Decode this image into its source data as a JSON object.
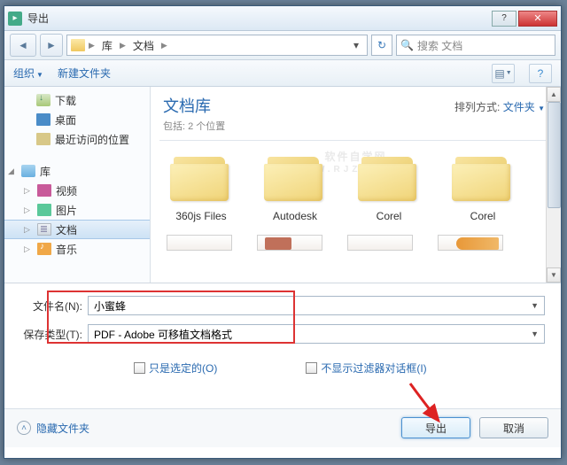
{
  "title": "导出",
  "breadcrumb": {
    "seg1": "库",
    "seg2": "文档"
  },
  "search_placeholder": "搜索 文档",
  "toolbar": {
    "organize": "组织",
    "newfolder": "新建文件夹"
  },
  "sidebar": {
    "downloads": "下载",
    "desktop": "桌面",
    "recent": "最近访问的位置",
    "libs": "库",
    "videos": "视频",
    "pictures": "图片",
    "docs": "文档",
    "music": "音乐"
  },
  "header": {
    "title": "文档库",
    "sub": "包括: 2 个位置"
  },
  "sort": {
    "label": "排列方式:",
    "value": "文件夹"
  },
  "items": {
    "a": "360js Files",
    "b": "Autodesk",
    "c": "Corel",
    "d": "Corel"
  },
  "form": {
    "fname_label": "文件名(N):",
    "fname_value": "小蜜蜂",
    "ftype_label": "保存类型(T):",
    "ftype_value": "PDF - Adobe 可移植文档格式"
  },
  "checks": {
    "sel": "只是选定的(O)",
    "nofilter": "不显示过滤器对话框(I)"
  },
  "footer": {
    "hide": "隐藏文件夹",
    "export": "导出",
    "cancel": "取消"
  },
  "watermark": {
    "big": "软件自学网",
    "small": "WWW.RJZXW.COM"
  }
}
